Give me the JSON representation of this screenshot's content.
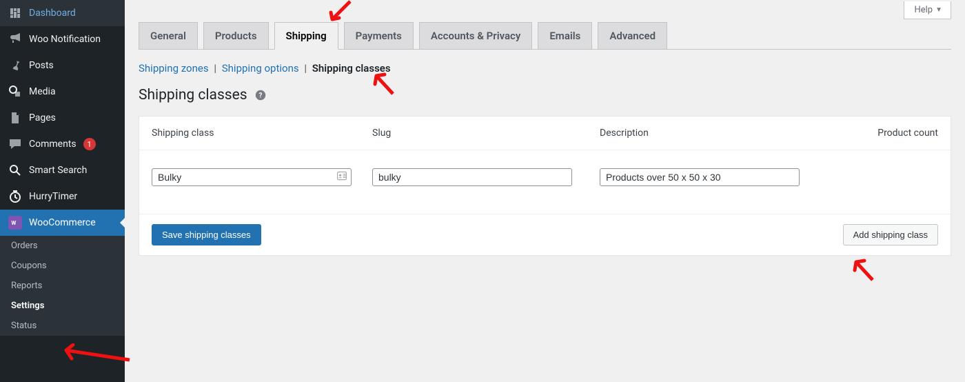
{
  "sidebar": {
    "items": [
      {
        "label": "Dashboard",
        "icon": "dashboard-icon"
      },
      {
        "label": "Woo Notification",
        "icon": "megaphone-icon"
      },
      {
        "label": "Posts",
        "icon": "pin-icon"
      },
      {
        "label": "Media",
        "icon": "media-icon"
      },
      {
        "label": "Pages",
        "icon": "page-icon"
      },
      {
        "label": "Comments",
        "icon": "comment-icon",
        "badge": "1"
      },
      {
        "label": "Smart Search",
        "icon": "search-icon"
      },
      {
        "label": "HurryTimer",
        "icon": "timer-icon"
      },
      {
        "label": "WooCommerce",
        "icon": "woo-icon",
        "current": true
      }
    ],
    "sub": [
      {
        "label": "Orders"
      },
      {
        "label": "Coupons"
      },
      {
        "label": "Reports"
      },
      {
        "label": "Settings",
        "current": true
      },
      {
        "label": "Status"
      }
    ]
  },
  "help_label": "Help",
  "tabs": [
    {
      "label": "General"
    },
    {
      "label": "Products"
    },
    {
      "label": "Shipping",
      "active": true
    },
    {
      "label": "Payments"
    },
    {
      "label": "Accounts & Privacy"
    },
    {
      "label": "Emails"
    },
    {
      "label": "Advanced"
    }
  ],
  "subnav": {
    "zones": "Shipping zones",
    "options": "Shipping options",
    "classes": "Shipping classes"
  },
  "page_title": "Shipping classes",
  "table": {
    "head": {
      "class": "Shipping class",
      "slug": "Slug",
      "desc": "Description",
      "count": "Product count"
    },
    "row": {
      "class": "Bulky",
      "slug": "bulky",
      "desc": "Products over 50 x 50 x 30"
    }
  },
  "buttons": {
    "save": "Save shipping classes",
    "add": "Add shipping class"
  }
}
